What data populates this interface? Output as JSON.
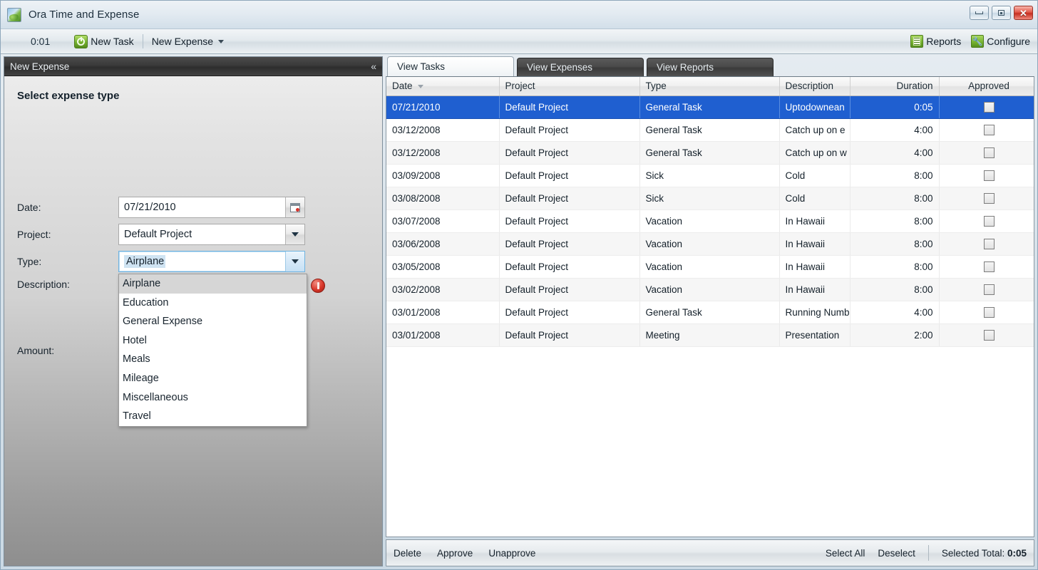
{
  "window": {
    "title": "Ora Time and Expense",
    "app_icon": "app-logo-icon",
    "minimize_label": "Minimize",
    "restore_label": "Restore",
    "close_label": "✕"
  },
  "toolbar": {
    "timer": "0:01",
    "new_task_label": "New Task",
    "new_expense_label": "New Expense",
    "reports_label": "Reports",
    "configure_label": "Configure"
  },
  "left_panel": {
    "header_title": "New Expense",
    "collapse_glyph": "«",
    "form_title": "Select expense type",
    "fields": {
      "date_label": "Date:",
      "date_value": "07/21/2010",
      "project_label": "Project:",
      "project_value": "Default Project",
      "type_label": "Type:",
      "type_value": "Airplane",
      "description_label": "Description:",
      "amount_label": "Amount:"
    },
    "type_options": [
      "Airplane",
      "Education",
      "General Expense",
      "Hotel",
      "Meals",
      "Mileage",
      "Miscellaneous",
      "Travel"
    ],
    "type_selected_option": "Airplane"
  },
  "right_panel": {
    "tabs": [
      {
        "label": "View Tasks",
        "active": true
      },
      {
        "label": "View Expenses",
        "active": false
      },
      {
        "label": "View Reports",
        "active": false
      }
    ],
    "grid": {
      "columns": [
        {
          "label": "Date",
          "align": "left",
          "sorted": true
        },
        {
          "label": "Project",
          "align": "left",
          "sorted": false
        },
        {
          "label": "Type",
          "align": "left",
          "sorted": false
        },
        {
          "label": "Description",
          "align": "left",
          "sorted": false
        },
        {
          "label": "Duration",
          "align": "right",
          "sorted": false
        },
        {
          "label": "Approved",
          "align": "center",
          "sorted": false
        }
      ],
      "rows": [
        {
          "date": "07/21/2010",
          "project": "Default Project",
          "type": "General Task",
          "description": "Uptodownean",
          "duration": "0:05",
          "approved": false,
          "selected": true
        },
        {
          "date": "03/12/2008",
          "project": "Default Project",
          "type": "General Task",
          "description": "Catch up on e",
          "duration": "4:00",
          "approved": false,
          "selected": false
        },
        {
          "date": "03/12/2008",
          "project": "Default Project",
          "type": "General Task",
          "description": "Catch up on w",
          "duration": "4:00",
          "approved": false,
          "selected": false
        },
        {
          "date": "03/09/2008",
          "project": "Default Project",
          "type": "Sick",
          "description": "Cold",
          "duration": "8:00",
          "approved": false,
          "selected": false
        },
        {
          "date": "03/08/2008",
          "project": "Default Project",
          "type": "Sick",
          "description": "Cold",
          "duration": "8:00",
          "approved": false,
          "selected": false
        },
        {
          "date": "03/07/2008",
          "project": "Default Project",
          "type": "Vacation",
          "description": "In Hawaii",
          "duration": "8:00",
          "approved": false,
          "selected": false
        },
        {
          "date": "03/06/2008",
          "project": "Default Project",
          "type": "Vacation",
          "description": "In Hawaii",
          "duration": "8:00",
          "approved": false,
          "selected": false
        },
        {
          "date": "03/05/2008",
          "project": "Default Project",
          "type": "Vacation",
          "description": "In Hawaii",
          "duration": "8:00",
          "approved": false,
          "selected": false
        },
        {
          "date": "03/02/2008",
          "project": "Default Project",
          "type": "Vacation",
          "description": "In Hawaii",
          "duration": "8:00",
          "approved": false,
          "selected": false
        },
        {
          "date": "03/01/2008",
          "project": "Default Project",
          "type": "General Task",
          "description": "Running Numb",
          "duration": "4:00",
          "approved": false,
          "selected": false
        },
        {
          "date": "03/01/2008",
          "project": "Default Project",
          "type": "Meeting",
          "description": "Presentation",
          "duration": "2:00",
          "approved": false,
          "selected": false
        }
      ]
    },
    "bottom_bar": {
      "delete_label": "Delete",
      "approve_label": "Approve",
      "unapprove_label": "Unapprove",
      "select_all_label": "Select All",
      "deselect_label": "Deselect",
      "total_label": "Selected Total:",
      "total_value": "0:05"
    }
  },
  "colors": {
    "selection_blue": "#1f5fd0",
    "accent_green": "#74b12e",
    "error_red": "#d9372a"
  }
}
